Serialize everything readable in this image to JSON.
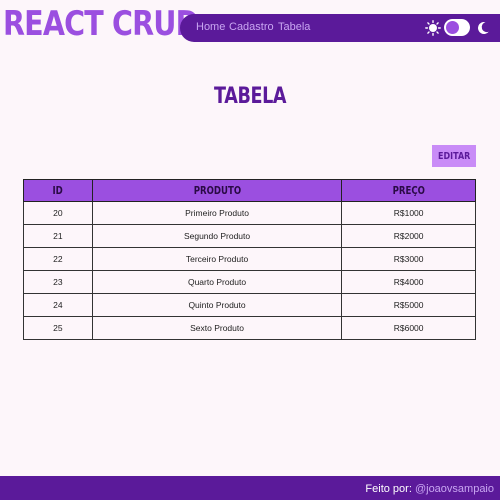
{
  "header": {
    "brand": "REACT CRUD",
    "nav": [
      {
        "label": "Home"
      },
      {
        "label": "Cadastro"
      },
      {
        "label": "Tabela"
      }
    ],
    "theme_toggle": {
      "light_icon": "sun-icon",
      "dark_icon": "moon-icon",
      "state": "light"
    }
  },
  "main": {
    "title": "TABELA",
    "edit_label": "EDITAR",
    "table": {
      "columns": [
        "ID",
        "PRODUTO",
        "PREÇO"
      ],
      "rows": [
        [
          "20",
          "Primeiro Produto",
          "R$1000"
        ],
        [
          "21",
          "Segundo Produto",
          "R$2000"
        ],
        [
          "22",
          "Terceiro Produto",
          "R$3000"
        ],
        [
          "23",
          "Quarto Produto",
          "R$4000"
        ],
        [
          "24",
          "Quinto Produto",
          "R$5000"
        ],
        [
          "25",
          "Sexto Produto",
          "R$6000"
        ]
      ]
    }
  },
  "footer": {
    "prefix": "Feito por:",
    "author": "@joaovsampaio"
  },
  "colors": {
    "accent": "#9b4fe0",
    "dark_purple": "#5b1a9a",
    "button": "#c98cf7",
    "background": "#fdf6fa"
  }
}
